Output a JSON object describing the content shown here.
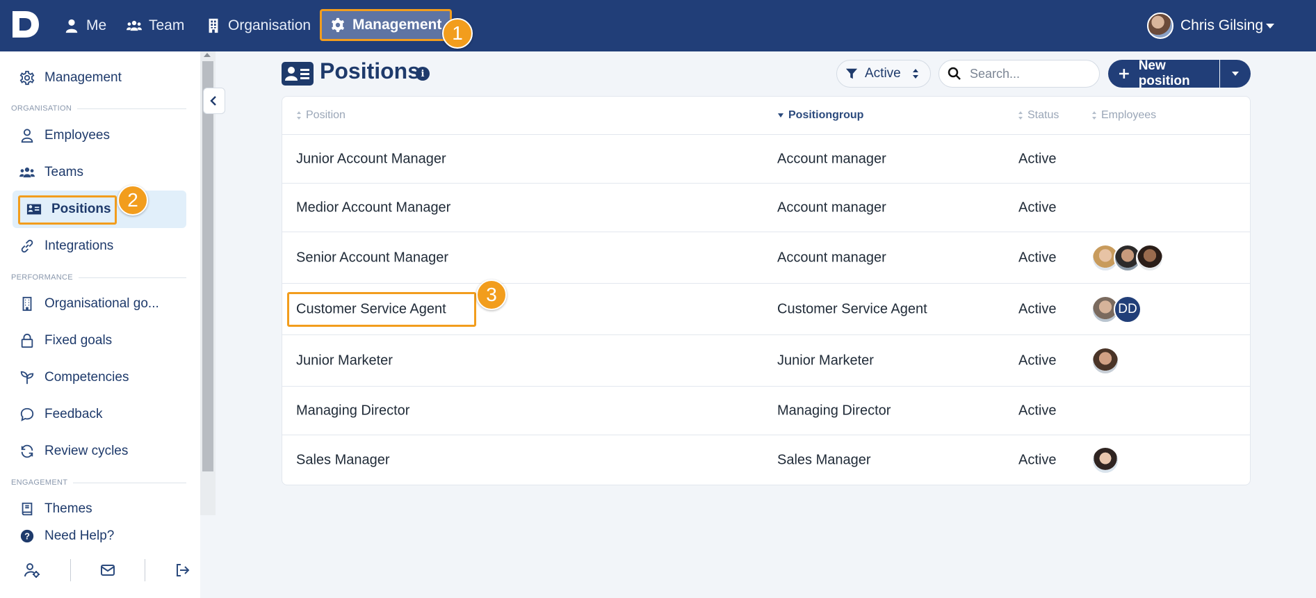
{
  "topnav": {
    "logo_letter": "D",
    "items": [
      {
        "label": "Me",
        "icon": "person-icon"
      },
      {
        "label": "Team",
        "icon": "people-icon"
      },
      {
        "label": "Organisation",
        "icon": "building-icon"
      },
      {
        "label": "Management",
        "icon": "gear-icon"
      }
    ],
    "user_name": "Chris Gilsing"
  },
  "annotations": [
    "1",
    "2",
    "3"
  ],
  "sidebar": {
    "top_item": "Management",
    "section_organisation": "ORGANISATION",
    "organisation_items": [
      "Employees",
      "Teams",
      "Positions",
      "Integrations"
    ],
    "section_performance": "PERFORMANCE",
    "performance_items": [
      "Organisational go...",
      "Fixed goals",
      "Competencies",
      "Feedback",
      "Review cycles"
    ],
    "section_engagement": "ENGAGEMENT",
    "engagement_items": [
      "Themes"
    ],
    "help": "Need Help?"
  },
  "page": {
    "title": "Positions",
    "filter_label": "Active",
    "search_placeholder": "Search...",
    "new_button": "New position"
  },
  "table": {
    "columns": [
      "Position",
      "Positiongroup",
      "Status",
      "Employees"
    ],
    "rows": [
      {
        "position": "Junior Account Manager",
        "group": "Account manager",
        "status": "Active",
        "employees": []
      },
      {
        "position": "Medior Account Manager",
        "group": "Account manager",
        "status": "Active",
        "employees": []
      },
      {
        "position": "Senior Account Manager",
        "group": "Account manager",
        "status": "Active",
        "employees": [
          "photo",
          "photo",
          "photo"
        ]
      },
      {
        "position": "Customer Service Agent",
        "group": "Customer Service Agent",
        "status": "Active",
        "employees": [
          "photo",
          "DD"
        ]
      },
      {
        "position": "Junior Marketer",
        "group": "Junior Marketer",
        "status": "Active",
        "employees": [
          "photo"
        ]
      },
      {
        "position": "Managing Director",
        "group": "Managing Director",
        "status": "Active",
        "employees": []
      },
      {
        "position": "Sales Manager",
        "group": "Sales Manager",
        "status": "Active",
        "employees": [
          "photo"
        ]
      }
    ]
  },
  "colors": {
    "brand": "#213e78",
    "highlight": "#f29d1d",
    "active_bg": "#e1effa"
  }
}
